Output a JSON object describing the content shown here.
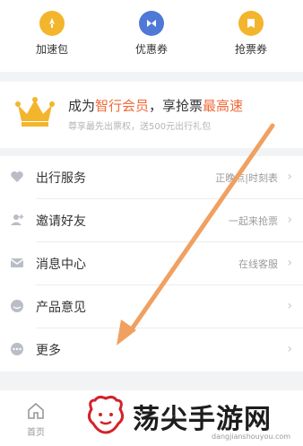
{
  "shortcuts": [
    {
      "label": "加速包",
      "icon": "rocket-icon",
      "color": "#f3b52b"
    },
    {
      "label": "优惠券",
      "icon": "coupon-icon",
      "color": "#4f79d6"
    },
    {
      "label": "抢票券",
      "icon": "ticket-icon",
      "color": "#f3b52b"
    }
  ],
  "vip": {
    "title_prefix": "成为",
    "title_highlight1": "智行会员",
    "title_middle": "，享抢票",
    "title_highlight2": "最高速",
    "subtitle": "尊享最先出票权，送500元出行礼包",
    "highlight_color": "#f06a3a",
    "crown_color": "#f3b52b"
  },
  "menu": [
    {
      "label": "出行服务",
      "right": "正晚点|时刻表",
      "icon": "heart-icon"
    },
    {
      "label": "邀请好友",
      "right": "一起来抢票",
      "icon": "user-add-icon"
    },
    {
      "label": "消息中心",
      "right": "在线客服",
      "icon": "mail-icon"
    },
    {
      "label": "产品意见",
      "right": "",
      "icon": "feedback-icon"
    },
    {
      "label": "更多",
      "right": "",
      "icon": "more-icon"
    }
  ],
  "tabbar": {
    "home_label": "首页"
  },
  "watermark": {
    "text": "荡尖手游网",
    "url": "dangjianshouyou.com"
  },
  "annotation": {
    "arrow_color": "#f0a060"
  }
}
